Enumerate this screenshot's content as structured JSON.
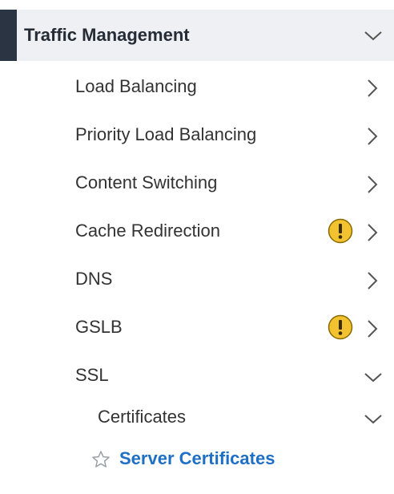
{
  "nav": {
    "section_title": "Traffic Management",
    "items": [
      {
        "label": "Load Balancing"
      },
      {
        "label": "Priority Load Balancing"
      },
      {
        "label": "Content Switching"
      },
      {
        "label": "Cache Redirection"
      },
      {
        "label": "DNS"
      },
      {
        "label": "GSLB"
      },
      {
        "label": "SSL"
      }
    ],
    "ssl_children": [
      {
        "label": "Certificates"
      }
    ],
    "certificates_children": [
      {
        "label": "Server Certificates"
      }
    ]
  },
  "icons": {
    "section_chevron": "chevron-down-icon",
    "item_chevron": "chevron-right-icon",
    "warning": "warning-icon",
    "favorite": "star-outline-icon"
  },
  "colors": {
    "header_bg": "#eef0f3",
    "header_accent": "#2b3442",
    "warning_fill": "#f2c230",
    "link_blue": "#1f6fc4"
  }
}
